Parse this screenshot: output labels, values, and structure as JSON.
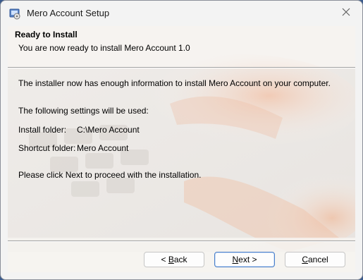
{
  "window": {
    "title": "Mero Account Setup"
  },
  "header": {
    "title": "Ready to Install",
    "subtitle": "You are now ready to install Mero Account 1.0"
  },
  "body": {
    "intro": "The installer now has enough information to install Mero Account on your computer.",
    "settings_heading": "The following settings will be used:",
    "install_folder_label": "Install folder:",
    "install_folder_value": "C:\\Mero Account",
    "shortcut_folder_label": "Shortcut folder:",
    "shortcut_folder_value": "Mero Account",
    "proceed_text": "Please click  Next to proceed with the installation."
  },
  "buttons": {
    "back_prefix": "< ",
    "back_accel": "B",
    "back_rest": "ack",
    "next_accel": "N",
    "next_rest": "ext >",
    "cancel_accel": "C",
    "cancel_rest": "ancel"
  },
  "colors": {
    "accent": "#4a7fc9",
    "close_icon": "#5c5c5c"
  }
}
